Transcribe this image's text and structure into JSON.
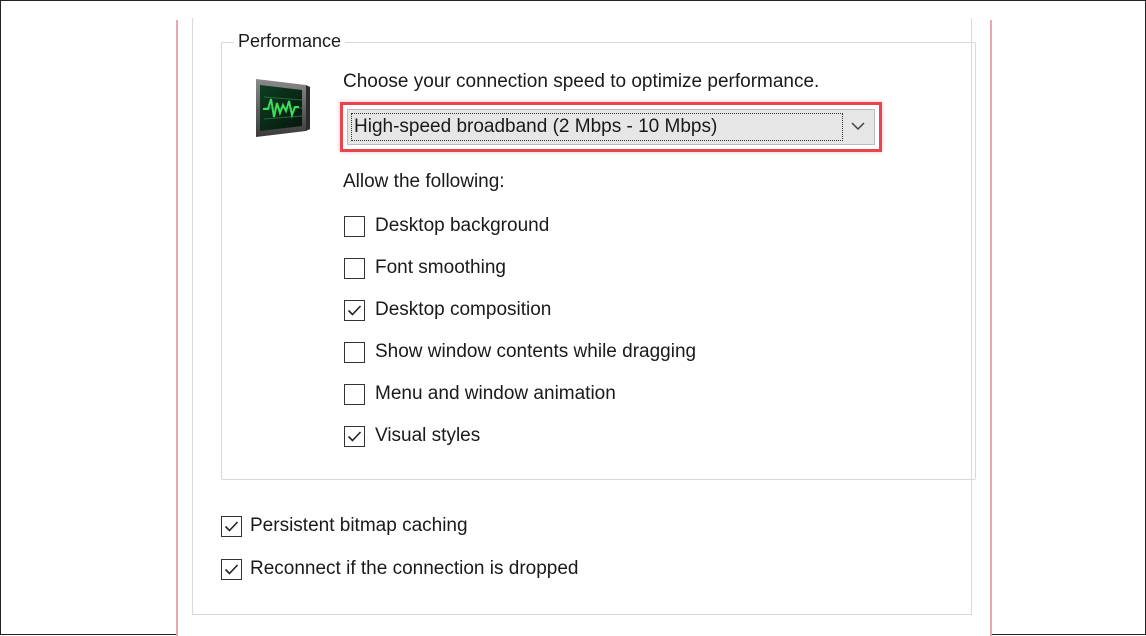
{
  "performance_group": {
    "legend": "Performance",
    "icon": "monitor-performance-icon",
    "choose_text": "Choose your connection speed to optimize performance.",
    "connection_speed": {
      "selected": "High-speed broadband (2 Mbps - 10 Mbps)"
    },
    "allow_text": "Allow the following:",
    "options": [
      {
        "label": "Desktop background",
        "checked": false
      },
      {
        "label": "Font smoothing",
        "checked": false
      },
      {
        "label": "Desktop composition",
        "checked": true
      },
      {
        "label": "Show window contents while dragging",
        "checked": false
      },
      {
        "label": "Menu and window animation",
        "checked": false
      },
      {
        "label": "Visual styles",
        "checked": true
      }
    ]
  },
  "bottom_options": [
    {
      "label": "Persistent bitmap caching",
      "checked": true
    },
    {
      "label": "Reconnect if the connection is dropped",
      "checked": true
    }
  ],
  "colors": {
    "highlight": "#e8464e",
    "window_border": "#e4a8ad",
    "graph_green": "#3ddc5a"
  }
}
